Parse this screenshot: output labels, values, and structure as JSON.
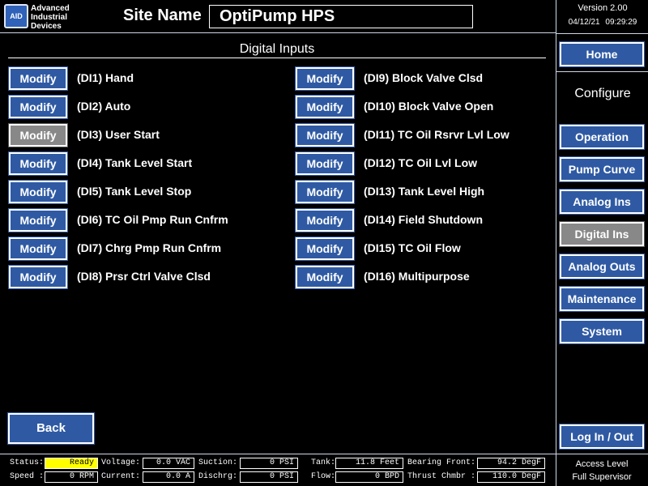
{
  "header": {
    "logo_mark": "AID",
    "logo_lines": [
      "Advanced",
      "Industrial",
      "Devices"
    ],
    "site_label": "Site Name",
    "site_name": "OptiPump HPS"
  },
  "right_panel": {
    "version": "Version 2.00",
    "date": "04/12/21",
    "time": "09:29:29",
    "home_label": "Home",
    "configure_label": "Configure",
    "nav": [
      {
        "label": "Operation",
        "active": false
      },
      {
        "label": "Pump Curve",
        "active": false
      },
      {
        "label": "Analog Ins",
        "active": false
      },
      {
        "label": "Digital Ins",
        "active": true
      },
      {
        "label": "Analog Outs",
        "active": false
      },
      {
        "label": "Maintenance",
        "active": false
      },
      {
        "label": "System",
        "active": false
      }
    ],
    "login_label": "Log In / Out"
  },
  "main": {
    "title": "Digital Inputs",
    "modify_label": "Modify",
    "back_label": "Back",
    "inputs": [
      {
        "label": "(DI1) Hand",
        "enabled": true
      },
      {
        "label": "(DI2) Auto",
        "enabled": true
      },
      {
        "label": "(DI3) User Start",
        "enabled": false
      },
      {
        "label": "(DI4) Tank Level Start",
        "enabled": true
      },
      {
        "label": "(DI5) Tank Level Stop",
        "enabled": true
      },
      {
        "label": "(DI6) TC Oil Pmp Run Cnfrm",
        "enabled": true
      },
      {
        "label": "(DI7) Chrg Pmp Run Cnfrm",
        "enabled": true
      },
      {
        "label": "(DI8) Prsr Ctrl Valve Clsd",
        "enabled": true
      },
      {
        "label": "(DI9) Block Valve Clsd",
        "enabled": true
      },
      {
        "label": "(DI10) Block Valve Open",
        "enabled": true
      },
      {
        "label": "(DI11) TC Oil Rsrvr Lvl Low",
        "enabled": true
      },
      {
        "label": "(DI12) TC Oil Lvl Low",
        "enabled": true
      },
      {
        "label": "(DI13) Tank Level High",
        "enabled": true
      },
      {
        "label": "(DI14) Field Shutdown",
        "enabled": true
      },
      {
        "label": "(DI15) TC Oil Flow",
        "enabled": true
      },
      {
        "label": "(DI16) Multipurpose",
        "enabled": true
      }
    ]
  },
  "status_bar": {
    "status_label": "Status:",
    "status_value": "Ready",
    "speed_label": "Speed :",
    "speed_value": "0 RPM",
    "voltage_label": "Voltage:",
    "voltage_value": "0.0 VAC",
    "current_label": "Current:",
    "current_value": "0.0 A",
    "suction_label": "Suction:",
    "suction_value": "0 PSI",
    "dischrg_label": "Dischrg:",
    "dischrg_value": "0 PSI",
    "tank_label": "Tank:",
    "tank_value": "11.8 Feet",
    "flow_label": "Flow:",
    "flow_value": "0 BPD",
    "bearing_label": "Bearing Front:",
    "bearing_value": "94.2 DegF",
    "thrust_label": "Thrust Chmbr :",
    "thrust_value": "110.0 DegF",
    "access_level": "Access Level",
    "access_role": "Full Supervisor"
  },
  "colors": {
    "button_blue": "#2f5aa3",
    "button_disabled": "#888888",
    "status_ready": "#ffff00",
    "background": "#000000"
  }
}
